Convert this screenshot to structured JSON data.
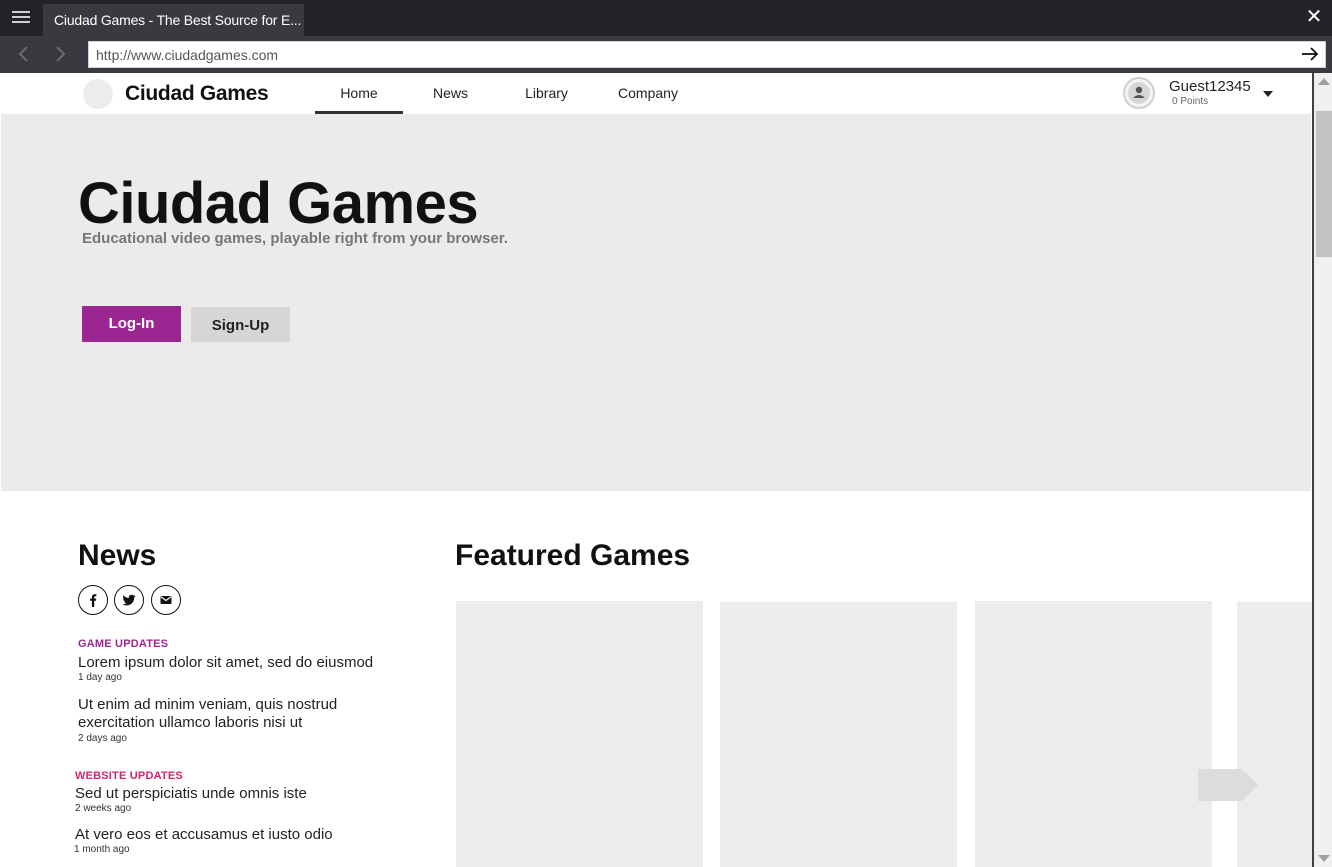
{
  "browser": {
    "tab_title": "Ciudad Games - The Best Source for E...",
    "url": "http://www.ciudadgames.com",
    "close_glyph": "✕",
    "back_glyph": "‹",
    "forward_glyph": "›"
  },
  "site": {
    "brand": "Ciudad Games",
    "nav": [
      {
        "label": "Home",
        "active": true
      },
      {
        "label": "News",
        "active": false
      },
      {
        "label": "Library",
        "active": false
      },
      {
        "label": "Company",
        "active": false
      }
    ],
    "user": {
      "name": "Guest12345",
      "points": "0 Points"
    }
  },
  "hero": {
    "title": "Ciudad Games",
    "subtitle": "Educational video games, playable right from your browser.",
    "login_label": "Log-In",
    "signup_label": "Sign-Up"
  },
  "news": {
    "heading": "News",
    "social_icons": [
      "facebook-icon",
      "twitter-icon",
      "mail-icon"
    ],
    "sections": [
      {
        "category": "GAME UPDATES",
        "color": "#9b2591",
        "items": [
          {
            "title": "Lorem ipsum dolor sit amet, sed do eiusmod",
            "time": "1 day ago"
          },
          {
            "title": "Ut enim ad minim veniam, quis nostrud exercitation ullamco laboris nisi ut",
            "time": "2 days ago"
          }
        ]
      },
      {
        "category": "WEBSITE UPDATES",
        "color": "#d6246e",
        "items": [
          {
            "title": "Sed ut perspiciatis unde omnis iste",
            "time": "2 weeks ago"
          },
          {
            "title": "At vero eos et accusamus et iusto odio",
            "time": "1 month ago"
          }
        ]
      }
    ]
  },
  "featured": {
    "heading": "Featured Games",
    "cards": 4
  },
  "colors": {
    "accent": "#9b2591",
    "hero_bg": "#ebebeb",
    "card_bg": "#ececec",
    "chrome_bg": "#232227"
  }
}
